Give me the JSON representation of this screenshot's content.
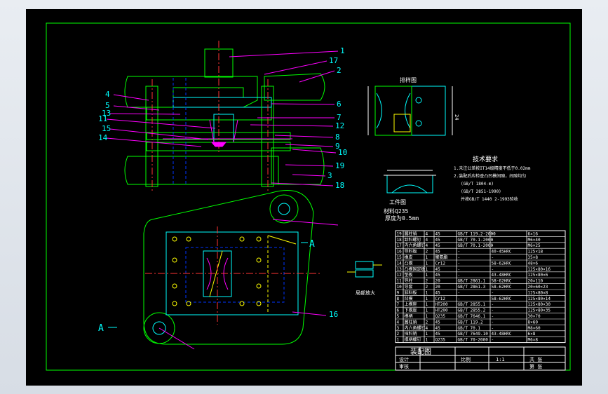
{
  "colors": {
    "background": "#000000",
    "frame": "#00ff00",
    "part": "#00ffff",
    "hidden": "#0033ff",
    "leader": "#ff00ff",
    "dim": "#ffffff",
    "center": "#ff3333",
    "section": "#ffff00"
  },
  "callouts_left": [
    "4",
    "5",
    "13",
    "11",
    "15",
    "14"
  ],
  "callouts_right": [
    "1",
    "17",
    "2",
    "6",
    "7",
    "12",
    "8",
    "9",
    "10",
    "19",
    "3",
    "18"
  ],
  "plan_callout": "16",
  "section_marks": [
    "A",
    "A"
  ],
  "detail_title": "排样图",
  "detail_width": "24",
  "tech_title": "技术要求",
  "tech_lines": [
    "1.未注公差按IT14级精度不低于0.02mm",
    "2.装配后应检查凸凹模间隙，间隙均匀",
    "(GB/T 1804-m)",
    "(GB/T 2851-1990)",
    "并按GB/T 1440 2-1993验收"
  ],
  "workpiece_title": "工件图",
  "workpiece_material": "材料Q235",
  "workpiece_thickness": "厚度为0.5mm",
  "small_section_label": "局部放大",
  "bom": [
    {
      "no": "19",
      "name": "圆柱销",
      "qty": "4",
      "mat": "45",
      "std": "GB/T 119.2-2000",
      "heat": "-",
      "spec": "6×16"
    },
    {
      "no": "18",
      "name": "卸料螺钉",
      "qty": "4",
      "mat": "45",
      "std": "GB/T 70.1-2000",
      "heat": "-",
      "spec": "M6×40"
    },
    {
      "no": "17",
      "name": "内六角螺钉",
      "qty": "4",
      "mat": "45",
      "std": "GB/T 70.1-2000",
      "heat": "-",
      "spec": "M6×25"
    },
    {
      "no": "16",
      "name": "导料板",
      "qty": "2",
      "mat": "45",
      "std": "-",
      "heat": "40-45HRC",
      "spec": "125×18"
    },
    {
      "no": "15",
      "name": "橡皮",
      "qty": "1",
      "mat": "聚氨酯",
      "std": "-",
      "heat": "-",
      "spec": "35×8"
    },
    {
      "no": "14",
      "name": "凸模",
      "qty": "1",
      "mat": "Cr12",
      "std": "-",
      "heat": "58-62HRC",
      "spec": "48×6"
    },
    {
      "no": "13",
      "name": "凸模固定板",
      "qty": "1",
      "mat": "45",
      "std": "-",
      "heat": "-",
      "spec": "125×80×16"
    },
    {
      "no": "12",
      "name": "垫板",
      "qty": "1",
      "mat": "45",
      "std": "-",
      "heat": "43-48HRC",
      "spec": "125×80×6"
    },
    {
      "no": "11",
      "name": "导柱",
      "qty": "2",
      "mat": "20",
      "std": "GB/T 2861.1",
      "heat": "58-62HRC",
      "spec": "20×110"
    },
    {
      "no": "10",
      "name": "导套",
      "qty": "2",
      "mat": "20",
      "std": "GB/T 2861.3",
      "heat": "58-62HRC",
      "spec": "20×60×23"
    },
    {
      "no": "9",
      "name": "卸料板",
      "qty": "1",
      "mat": "45",
      "std": "-",
      "heat": "-",
      "spec": "125×80×8"
    },
    {
      "no": "8",
      "name": "凹模",
      "qty": "1",
      "mat": "Cr12",
      "std": "-",
      "heat": "58-62HRC",
      "spec": "125×80×14"
    },
    {
      "no": "7",
      "name": "上模座",
      "qty": "1",
      "mat": "HT200",
      "std": "GB/T 2855.1",
      "heat": "-",
      "spec": "125×80×30"
    },
    {
      "no": "6",
      "name": "下模座",
      "qty": "1",
      "mat": "HT200",
      "std": "GB/T 2855.2",
      "heat": "-",
      "spec": "125×80×35"
    },
    {
      "no": "5",
      "name": "模柄",
      "qty": "1",
      "mat": "Q235",
      "std": "GB/T 7646.1",
      "heat": "-",
      "spec": "30×70"
    },
    {
      "no": "4",
      "name": "圆柱销",
      "qty": "2",
      "mat": "45",
      "std": "GB/T 119.2",
      "heat": "-",
      "spec": "8×60"
    },
    {
      "no": "3",
      "name": "内六角螺钉",
      "qty": "4",
      "mat": "45",
      "std": "GB/T 70.1",
      "heat": "-",
      "spec": "M8×60"
    },
    {
      "no": "2",
      "name": "挡料销",
      "qty": "1",
      "mat": "45",
      "std": "GB/T 7649.10",
      "heat": "43-48HRC",
      "spec": "6×8"
    },
    {
      "no": "1",
      "name": "模柄螺钉",
      "qty": "1",
      "mat": "Q235",
      "std": "GB/T 70-2000",
      "heat": "-",
      "spec": "M6×8"
    }
  ],
  "title_block": {
    "title": "装配图",
    "row2": [
      "设计",
      "",
      "比例",
      "1:1",
      "共 张"
    ],
    "row3": [
      "审核",
      "",
      "",
      "",
      "第 张"
    ]
  }
}
